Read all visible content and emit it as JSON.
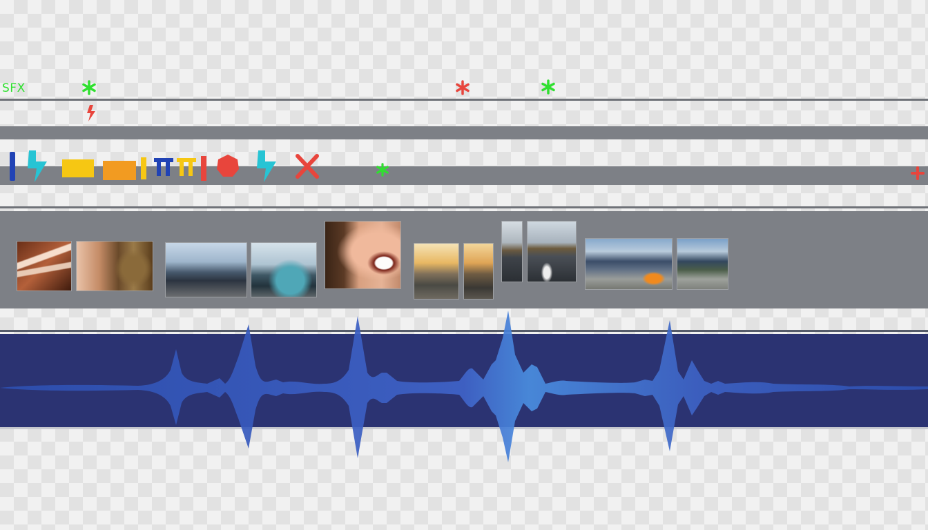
{
  "sfx_track": {
    "label": "SFX"
  },
  "colors": {
    "accent_green": "#2fe02f",
    "accent_red": "#e8453c",
    "track_gray": "#7d8086",
    "audio_navy": "#2b3372",
    "waveform_blue": "#3f63c8"
  },
  "icons": [
    "asterisk-icon",
    "lightning-icon",
    "bar-icon",
    "rectangle-icon",
    "t-glyph-icon",
    "hexagon-icon",
    "x-icon",
    "plus-icon"
  ],
  "video_clips": [
    "hands-clip",
    "texture-clip",
    "speeding-car-clip",
    "blue-car-clip",
    "laughing-woman-clip",
    "sunset-road-clip",
    "road-clip",
    "track-left-clip",
    "racetrack-clip",
    "mountain-car-clip",
    "mountain-road-clip"
  ]
}
